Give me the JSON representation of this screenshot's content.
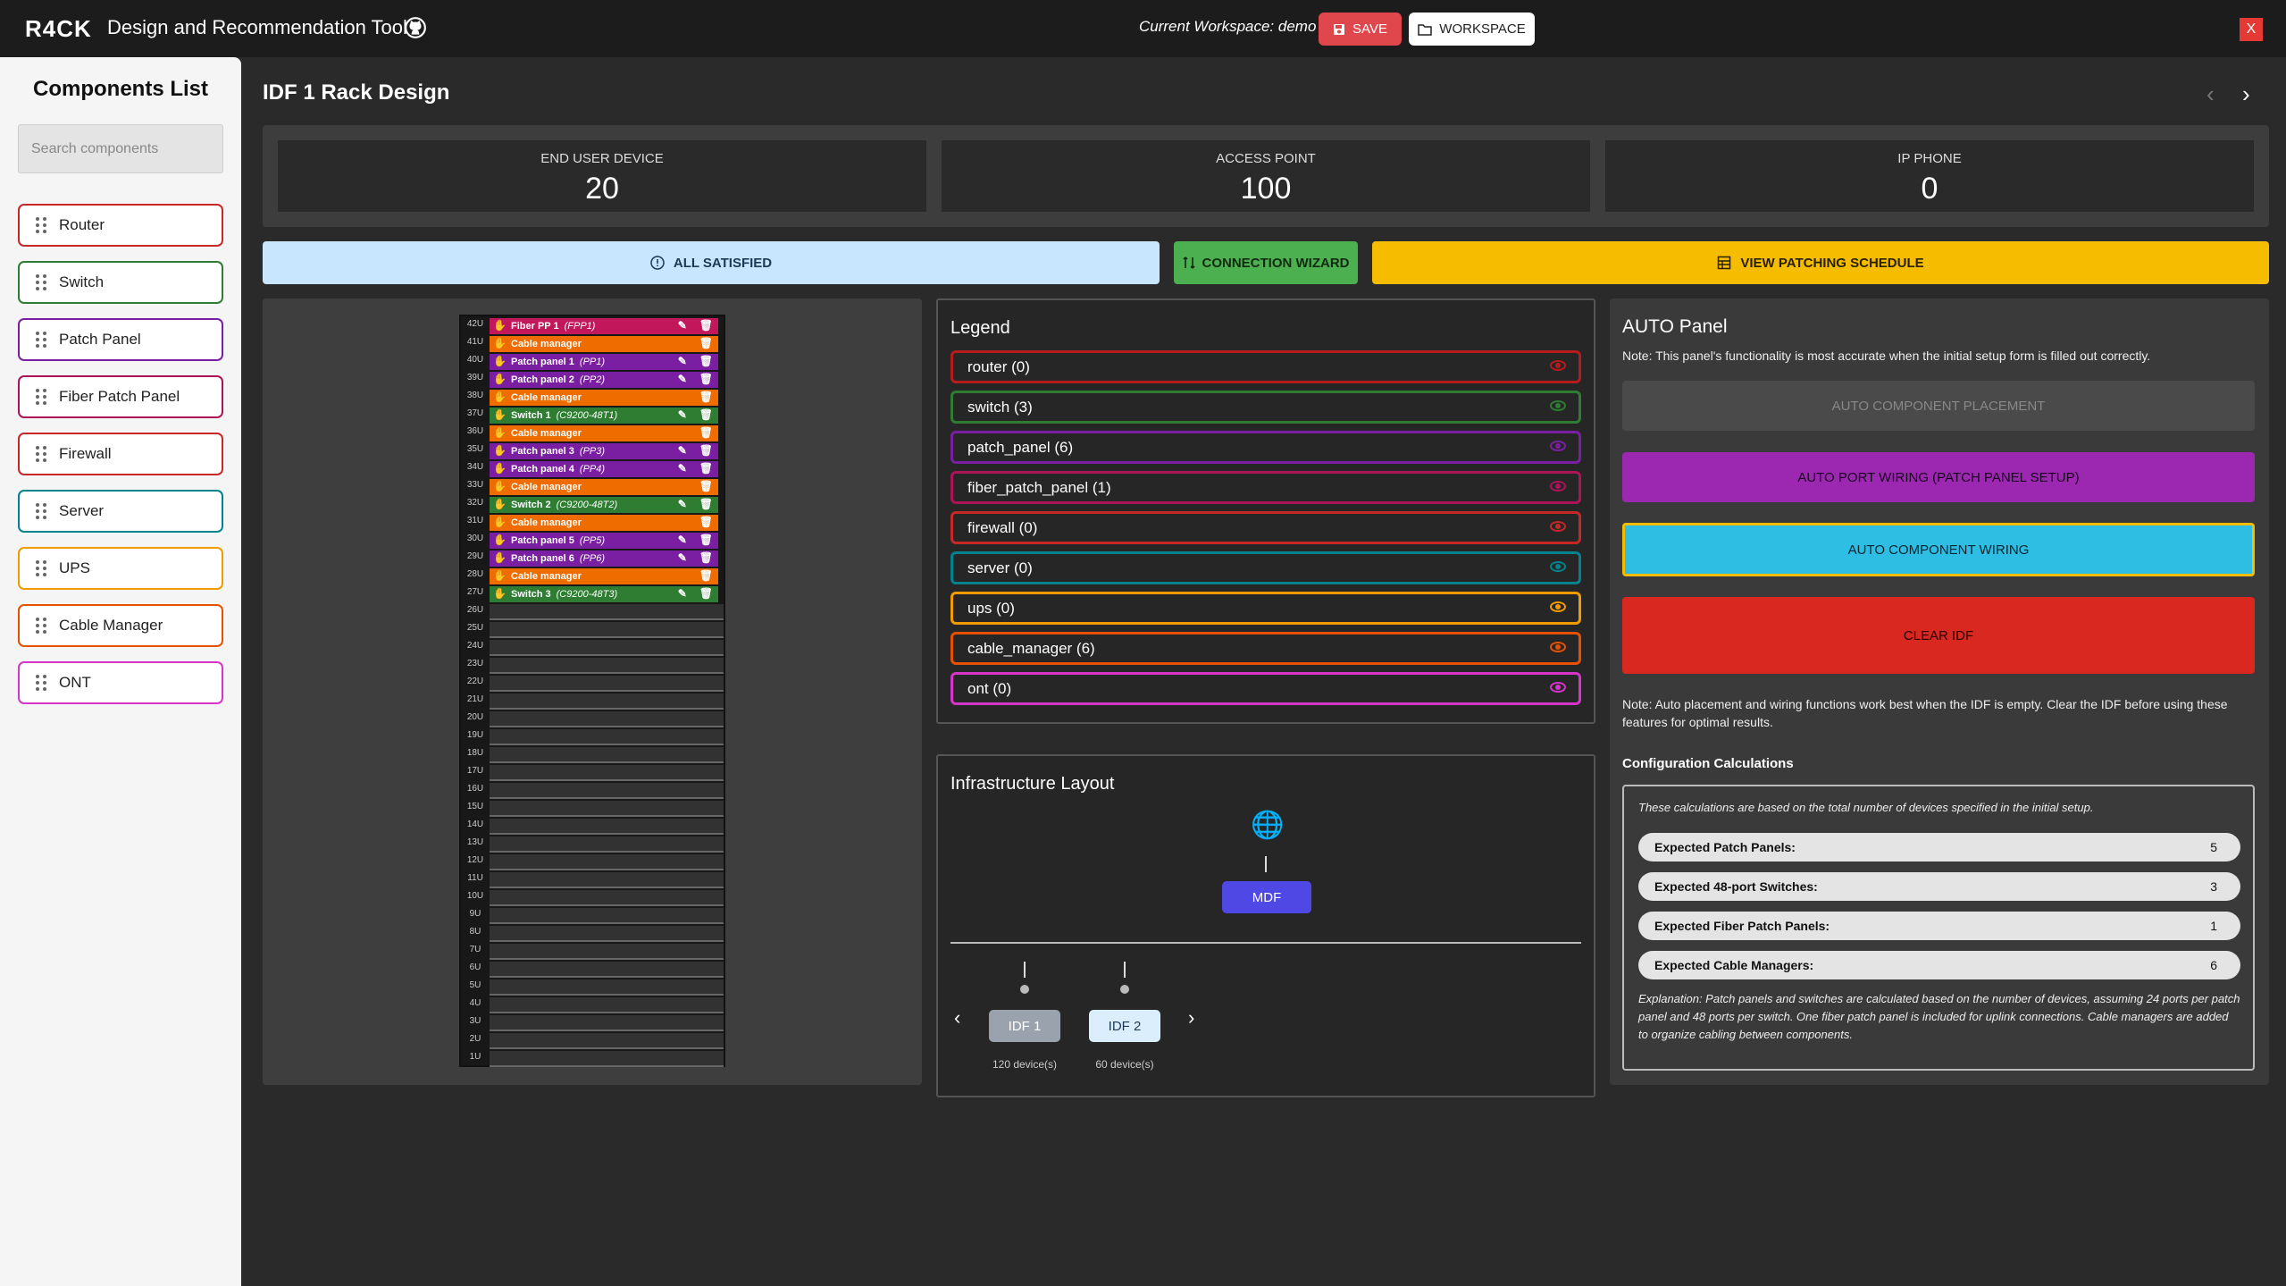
{
  "app": {
    "logo": "R4CK",
    "title": "Design and Recommendation Tool",
    "workspace_label": "Current Workspace: demo",
    "save_label": "SAVE",
    "workspace_button": "WORKSPACE",
    "close_label": "X"
  },
  "sidebar": {
    "title": "Components List",
    "search_placeholder": "Search components",
    "items": [
      {
        "label": "Router",
        "color": "#c62828"
      },
      {
        "label": "Switch",
        "color": "#2e7d32"
      },
      {
        "label": "Patch Panel",
        "color": "#7b1fa2"
      },
      {
        "label": "Fiber Patch Panel",
        "color": "#ad1457"
      },
      {
        "label": "Firewall",
        "color": "#c62828"
      },
      {
        "label": "Server",
        "color": "#00838f"
      },
      {
        "label": "UPS",
        "color": "#f29b00"
      },
      {
        "label": "Cable Manager",
        "color": "#e65100"
      },
      {
        "label": "ONT",
        "color": "#d535c8"
      }
    ]
  },
  "main": {
    "title": "IDF 1 Rack Design"
  },
  "stats": [
    {
      "label": "END USER DEVICE",
      "value": "20"
    },
    {
      "label": "ACCESS POINT",
      "value": "100"
    },
    {
      "label": "IP PHONE",
      "value": "0"
    }
  ],
  "actions": {
    "all_satisfied": "ALL SATISFIED",
    "connection_wizard": "CONNECTION WIZARD",
    "view_patching": "VIEW PATCHING SCHEDULE"
  },
  "rack": {
    "units": [
      "42U",
      "41U",
      "40U",
      "39U",
      "38U",
      "37U",
      "36U",
      "35U",
      "34U",
      "33U",
      "32U",
      "31U",
      "30U",
      "29U",
      "28U",
      "27U",
      "26U",
      "25U",
      "24U",
      "23U",
      "22U",
      "21U",
      "20U",
      "19U",
      "18U",
      "17U",
      "16U",
      "15U",
      "14U",
      "13U",
      "12U",
      "11U",
      "10U",
      "9U",
      "8U",
      "7U",
      "6U",
      "5U",
      "4U",
      "3U",
      "2U",
      "1U"
    ],
    "devices": [
      {
        "name": "Fiber PP  1",
        "model": "(FPP1)",
        "color": "#c2185b",
        "editable": true
      },
      {
        "name": "Cable manager",
        "model": "",
        "color": "#ef6c00",
        "editable": false
      },
      {
        "name": "Patch panel  1",
        "model": "(PP1)",
        "color": "#7b1fa2",
        "editable": true
      },
      {
        "name": "Patch panel  2",
        "model": "(PP2)",
        "color": "#7b1fa2",
        "editable": true
      },
      {
        "name": "Cable manager",
        "model": "",
        "color": "#ef6c00",
        "editable": false
      },
      {
        "name": "Switch  1",
        "model": "(C9200-48T1)",
        "color": "#2e7d32",
        "editable": true
      },
      {
        "name": "Cable manager",
        "model": "",
        "color": "#ef6c00",
        "editable": false
      },
      {
        "name": "Patch panel  3",
        "model": "(PP3)",
        "color": "#7b1fa2",
        "editable": true
      },
      {
        "name": "Patch panel  4",
        "model": "(PP4)",
        "color": "#7b1fa2",
        "editable": true
      },
      {
        "name": "Cable manager",
        "model": "",
        "color": "#ef6c00",
        "editable": false
      },
      {
        "name": "Switch  2",
        "model": "(C9200-48T2)",
        "color": "#2e7d32",
        "editable": true
      },
      {
        "name": "Cable manager",
        "model": "",
        "color": "#ef6c00",
        "editable": false
      },
      {
        "name": "Patch panel  5",
        "model": "(PP5)",
        "color": "#7b1fa2",
        "editable": true
      },
      {
        "name": "Patch panel  6",
        "model": "(PP6)",
        "color": "#7b1fa2",
        "editable": true
      },
      {
        "name": "Cable manager",
        "model": "",
        "color": "#ef6c00",
        "editable": false
      },
      {
        "name": "Switch  3",
        "model": "(C9200-48T3)",
        "color": "#2e7d32",
        "editable": true
      }
    ]
  },
  "legend": {
    "title": "Legend",
    "items": [
      {
        "label": "router (0)",
        "color": "#b71c1c"
      },
      {
        "label": "switch (3)",
        "color": "#2e7d32"
      },
      {
        "label": "patch_panel (6)",
        "color": "#7b1fa2"
      },
      {
        "label": "fiber_patch_panel (1)",
        "color": "#ad1457"
      },
      {
        "label": "firewall (0)",
        "color": "#c62828"
      },
      {
        "label": "server (0)",
        "color": "#00838f"
      },
      {
        "label": "ups (0)",
        "color": "#f29b00"
      },
      {
        "label": "cable_manager (6)",
        "color": "#e65100"
      },
      {
        "label": "ont (0)",
        "color": "#d535c8"
      }
    ]
  },
  "infra": {
    "title": "Infrastructure Layout",
    "mdf": "MDF",
    "idfs": [
      {
        "label": "IDF 1",
        "count": "120 device(s)"
      },
      {
        "label": "IDF 2",
        "count": "60 device(s)"
      }
    ]
  },
  "auto_panel": {
    "title": "AUTO Panel",
    "note": "Note: This panel's functionality is most accurate when the initial setup form is filled out correctly.",
    "btn_placement": "AUTO COMPONENT PLACEMENT",
    "btn_port_wiring": "AUTO PORT WIRING (PATCH PANEL SETUP)",
    "btn_component_wiring": "AUTO COMPONENT WIRING",
    "btn_clear": "CLEAR IDF",
    "note2": "Note: Auto placement and wiring functions work best when the IDF is empty. Clear the IDF before using these features for optimal results.",
    "config_title": "Configuration Calculations",
    "config_intro": "These calculations are based on the total number of devices specified in the initial setup.",
    "rows": [
      {
        "label": "Expected Patch Panels:",
        "value": "5"
      },
      {
        "label": "Expected 48-port Switches:",
        "value": "3"
      },
      {
        "label": "Expected Fiber Patch Panels:",
        "value": "1"
      },
      {
        "label": "Expected Cable Managers:",
        "value": "6"
      }
    ],
    "explanation": "Explanation: Patch panels and switches are calculated based on the number of devices, assuming 24 ports per patch panel and 48 ports per switch. One fiber patch panel is included for uplink connections. Cable managers are added to organize cabling between components."
  }
}
